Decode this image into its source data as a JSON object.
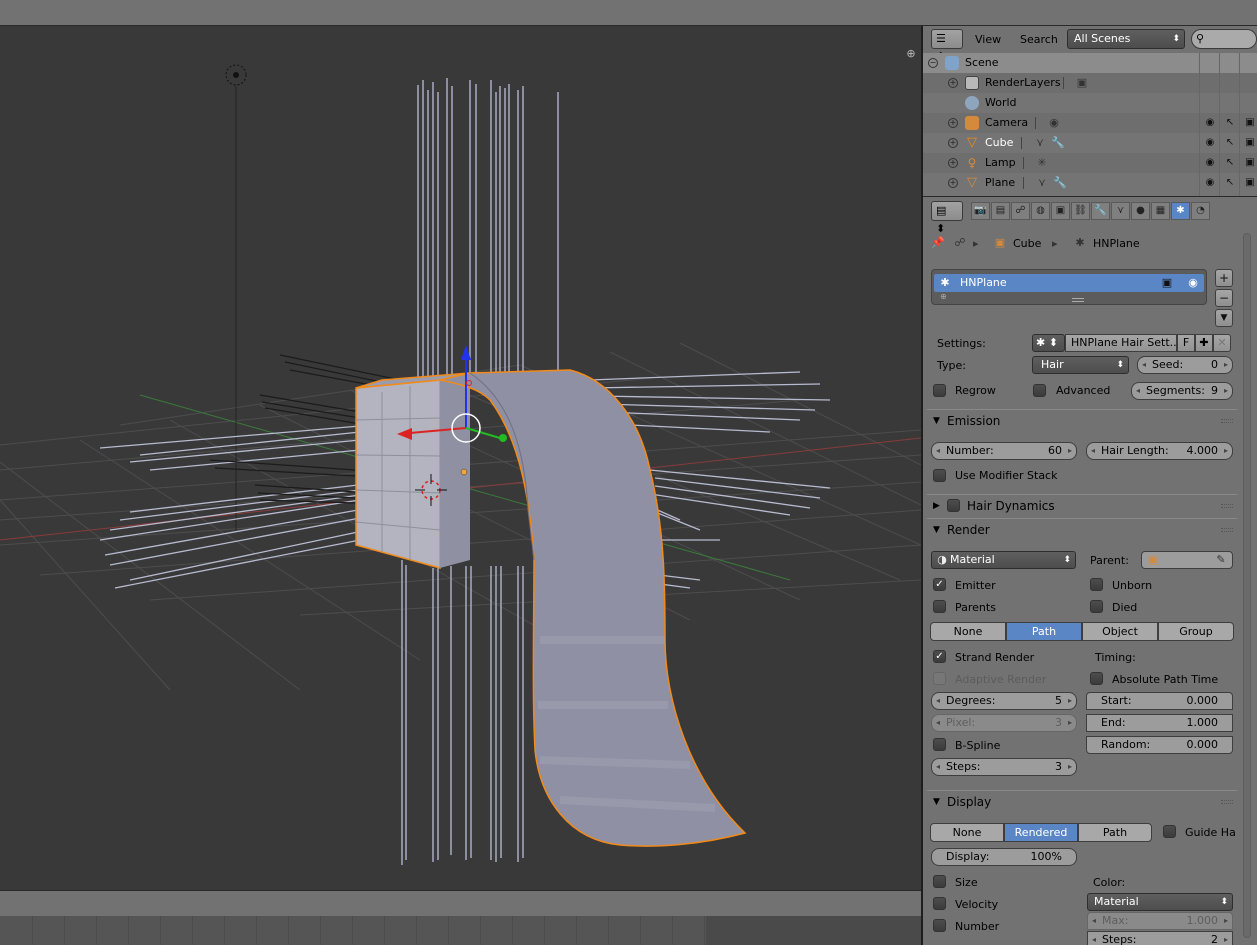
{
  "outliner": {
    "menu_view": "View",
    "menu_search": "Search",
    "scenes_dropdown": "All Scenes",
    "rows": [
      {
        "label": "Scene"
      },
      {
        "label": "RenderLayers"
      },
      {
        "label": "World"
      },
      {
        "label": "Camera"
      },
      {
        "label": "Cube"
      },
      {
        "label": "Lamp"
      },
      {
        "label": "Plane"
      }
    ]
  },
  "properties": {
    "breadcrumb": {
      "object": "Cube",
      "system": "HNPlane"
    },
    "particle_list": {
      "item": "HNPlane"
    },
    "settings": {
      "settings_label": "Settings:",
      "settings_value": "HNPlane Hair Sett...",
      "fake_user": "F",
      "type_label": "Type:",
      "type_value": "Hair",
      "seed_label": "Seed:",
      "seed_value": "0",
      "regrow_label": "Regrow",
      "advanced_label": "Advanced",
      "segments_label": "Segments:",
      "segments_value": "9"
    },
    "emission": {
      "title": "Emission",
      "number_label": "Number:",
      "number_value": "60",
      "hair_length_label": "Hair Length:",
      "hair_length_value": "4.000",
      "use_modifier_stack": "Use Modifier Stack"
    },
    "hair_dynamics": {
      "title": "Hair Dynamics"
    },
    "render": {
      "title": "Render",
      "material_value": "Material",
      "parent_label": "Parent:",
      "emitter_label": "Emitter",
      "unborn_label": "Unborn",
      "parents_label": "Parents",
      "died_label": "Died",
      "render_as": [
        "None",
        "Path",
        "Object",
        "Group"
      ],
      "render_as_selected": "Path",
      "strand_render": "Strand Render",
      "timing_label": "Timing:",
      "adaptive_render": "Adaptive Render",
      "absolute_path_time": "Absolute Path Time",
      "degrees_label": "Degrees:",
      "degrees_value": "5",
      "start_label": "Start:",
      "start_value": "0.000",
      "pixel_label": "Pixel:",
      "pixel_value": "3",
      "end_label": "End:",
      "end_value": "1.000",
      "bspline_label": "B-Spline",
      "random_label": "Random:",
      "random_value": "0.000",
      "steps_label": "Steps:",
      "steps_value": "3"
    },
    "display": {
      "title": "Display",
      "display_as": [
        "None",
        "Rendered",
        "Path"
      ],
      "display_as_selected": "Rendered",
      "guide_hairs": "Guide Ha",
      "display_label": "Display:",
      "display_value": "100%",
      "size_label": "Size",
      "color_label": "Color:",
      "velocity_label": "Velocity",
      "color_value": "Material",
      "number_label": "Number",
      "max_label": "Max:",
      "max_value": "1.000",
      "steps_label": "Steps:",
      "steps_value": "2"
    }
  },
  "colors": {
    "selection_orange": "#f28a1a",
    "active_blue": "#5a86c6",
    "mesh_gray": "#9a9bab"
  }
}
